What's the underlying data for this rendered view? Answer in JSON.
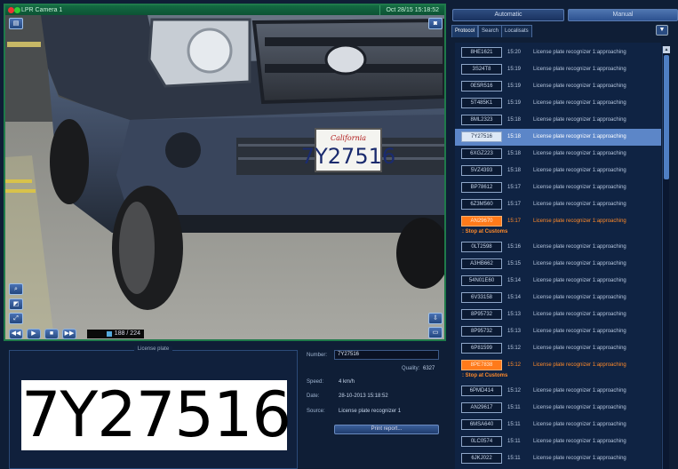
{
  "camera": {
    "title": "LPR Camera 1",
    "timestamp": "Oct 28/15 15:18:52",
    "frame_counter": "188 / 224",
    "plate_in_scene": "7Y27516",
    "plate_top_script": "California"
  },
  "plate_panel": {
    "legend": "License plate",
    "number": "7Y27516"
  },
  "details": {
    "number_label": "Number:",
    "number_value": "7Y27516",
    "quality_label": "Quality:",
    "quality_value": "6327",
    "speed_label": "Speed:",
    "speed_value": "4 km/h",
    "date_label": "Date:",
    "date_value": "28-10-2013 15:18:52",
    "source_label": "Source:",
    "source_value": "License plate recognizer 1",
    "print_button": "Print report..."
  },
  "mode": {
    "automatic": "Automatic",
    "manual": "Manual"
  },
  "tabs": [
    "Protocol",
    "Search",
    "Localisats"
  ],
  "events": [
    {
      "plate": "8HE1621",
      "time": "15:20",
      "desc": "License plate recognizer 1:approaching",
      "state": "normal"
    },
    {
      "plate": "3S24T8",
      "time": "15:19",
      "desc": "License plate recognizer 1:approaching",
      "state": "normal"
    },
    {
      "plate": "0E5R516",
      "time": "15:19",
      "desc": "License plate recognizer 1:approaching",
      "state": "normal"
    },
    {
      "plate": "5T485K1",
      "time": "15:19",
      "desc": "License plate recognizer 1:approaching",
      "state": "normal"
    },
    {
      "plate": "8ML2323",
      "time": "15:18",
      "desc": "License plate recognizer 1:approaching",
      "state": "normal"
    },
    {
      "plate": "7Y27516",
      "time": "15:18",
      "desc": "License plate recognizer 1:approaching",
      "state": "selected"
    },
    {
      "plate": "6XGZ223",
      "time": "15:18",
      "desc": "License plate recognizer 1:approaching",
      "state": "normal"
    },
    {
      "plate": "5VZ4393",
      "time": "15:18",
      "desc": "License plate recognizer 1:approaching",
      "state": "normal"
    },
    {
      "plate": "BP78612",
      "time": "15:17",
      "desc": "License plate recognizer 1:approaching",
      "state": "normal"
    },
    {
      "plate": "6Z3M560",
      "time": "15:17",
      "desc": "License plate recognizer 1:approaching",
      "state": "normal"
    },
    {
      "plate": "AN29670",
      "time": "15:17",
      "desc": "License plate recognizer 1:approaching",
      "state": "warn",
      "note": ": Stop at Customs"
    },
    {
      "plate": "0LT2598",
      "time": "15:16",
      "desc": "License plate recognizer 1:approaching",
      "state": "normal"
    },
    {
      "plate": "A3HB662",
      "time": "15:15",
      "desc": "License plate recognizer 1:approaching",
      "state": "normal"
    },
    {
      "plate": "54N01E60",
      "time": "15:14",
      "desc": "License plate recognizer 1:approaching",
      "state": "normal"
    },
    {
      "plate": "6V33158",
      "time": "15:14",
      "desc": "License plate recognizer 1:approaching",
      "state": "normal"
    },
    {
      "plate": "8P95732",
      "time": "15:13",
      "desc": "License plate recognizer 1:approaching",
      "state": "normal"
    },
    {
      "plate": "8P95732",
      "time": "15:13",
      "desc": "License plate recognizer 1:approaching",
      "state": "normal"
    },
    {
      "plate": "6P81599",
      "time": "15:12",
      "desc": "License plate recognizer 1:approaching",
      "state": "normal"
    },
    {
      "plate": "8PE7838",
      "time": "15:12",
      "desc": "License plate recognizer 1:approaching",
      "state": "warn",
      "note": ": Stop at Customs"
    },
    {
      "plate": "6PMD414",
      "time": "15:12",
      "desc": "License plate recognizer 1:approaching",
      "state": "normal"
    },
    {
      "plate": "AN29617",
      "time": "15:11",
      "desc": "License plate recognizer 1:approaching",
      "state": "normal"
    },
    {
      "plate": "6MSA640",
      "time": "15:11",
      "desc": "License plate recognizer 1:approaching",
      "state": "normal"
    },
    {
      "plate": "0LC0574",
      "time": "15:11",
      "desc": "License plate recognizer 1:approaching",
      "state": "normal"
    },
    {
      "plate": "6JKJ022",
      "time": "15:11",
      "desc": "License plate recognizer 1:approaching",
      "state": "normal"
    }
  ],
  "colors": {
    "accent": "#5c86c8",
    "warn": "#ff7a1a",
    "panel": "#0f1e36"
  },
  "icons": {
    "camera_menu": "menu-icon",
    "snapshot": "snapshot-icon",
    "zoom": "zoom-icon",
    "fullscreen": "fullscreen-icon",
    "filter": "filter-icon"
  }
}
